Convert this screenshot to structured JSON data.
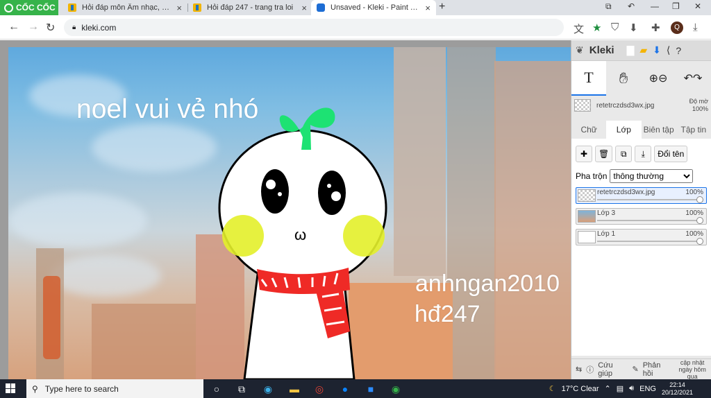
{
  "browser": {
    "brand": "CỐC CỐC",
    "tabs": [
      {
        "title": "Hỏi đáp môn Âm nhạc, Mỹ thuật",
        "active": false
      },
      {
        "title": "Hỏi đáp 247 - trang tra loi",
        "active": false
      },
      {
        "title": "Unsaved - Kleki - Paint Tool",
        "active": true
      }
    ],
    "url": "kleki.com"
  },
  "canvas": {
    "text_top": "noel vui vẻ nhó",
    "text_name": "anhngan2010",
    "text_tag": "hđ247",
    "face_mouth": "ω"
  },
  "kleki": {
    "app_name": "Kleki",
    "file_name": "retetrczdsd3wx.jpg",
    "opacity_label": "Độ mờ",
    "opacity_value": "100%",
    "tabs": [
      "Chữ",
      "Lớp",
      "Biên tập",
      "Tập tin"
    ],
    "active_tab": "Lớp",
    "rename_label": "Đổi tên",
    "blend_label": "Pha trộn",
    "blend_value": "thông thường",
    "layers": [
      {
        "name": "retetrczdsd3wx.jpg",
        "opacity": "100%",
        "active": true
      },
      {
        "name": "Lớp 3",
        "opacity": "100%",
        "active": false
      },
      {
        "name": "Lớp 1",
        "opacity": "100%",
        "active": false
      }
    ],
    "help_label": "Cứu giúp",
    "feedback_label": "Phản hồi",
    "update_label": "cập nhật ngày hôm qua"
  },
  "taskbar": {
    "search_placeholder": "Type here to search",
    "weather": "17°C  Clear",
    "language": "ENG",
    "time": "22:14",
    "date": "20/12/2021"
  }
}
